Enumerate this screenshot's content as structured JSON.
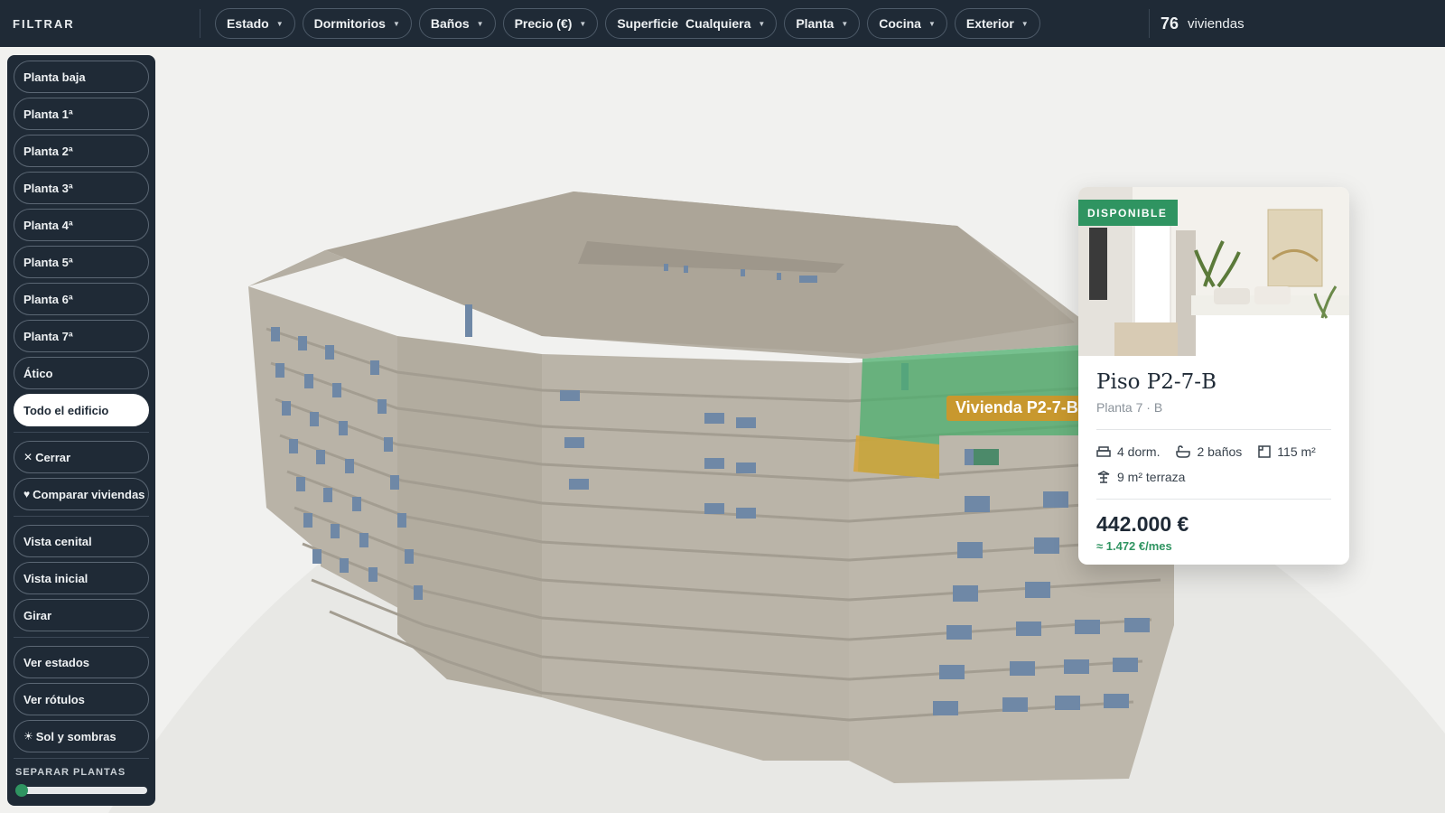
{
  "topbar": {
    "brand": "FILTRAR",
    "filters": [
      {
        "label": "Estado",
        "value": ""
      },
      {
        "label": "Dormitorios",
        "value": ""
      },
      {
        "label": "Baños",
        "value": ""
      },
      {
        "label": "Precio (€)",
        "value": ""
      },
      {
        "label": "Superficie",
        "value": "Cualquiera"
      },
      {
        "label": "Planta",
        "value": ""
      },
      {
        "label": "Cocina",
        "value": ""
      },
      {
        "label": "Exterior",
        "value": ""
      }
    ],
    "count": "76",
    "count_label": "viviendas"
  },
  "sidebar": {
    "floors": [
      "Planta baja",
      "Planta 1ª",
      "Planta 2ª",
      "Planta 3ª",
      "Planta 4ª",
      "Planta 5ª",
      "Planta 6ª",
      "Planta 7ª",
      "Ático",
      "Todo el edificio"
    ],
    "active_floor": "Todo el edificio",
    "close_label": "Cerrar",
    "compare_label": "Comparar viviendas",
    "views": [
      "Vista cenital",
      "Vista inicial",
      "Girar"
    ],
    "toggles": [
      "Ver estados",
      "Ver rótulos",
      "Sol y sombras"
    ],
    "slider_label": "SEPARAR PLANTAS",
    "slider_value": 0
  },
  "scene": {
    "unit_label": "Vivienda P2-7-B",
    "highlight_color": "#4caf6e",
    "terrace_color": "#d8a53a"
  },
  "card": {
    "status": "DISPONIBLE",
    "title": "Piso P2-7-B",
    "subtitle": "Planta 7 · B",
    "bedrooms": "4 dorm.",
    "bathrooms": "2 baños",
    "area": "115 m²",
    "terrace": "9 m² terraza",
    "price": "442.000 €",
    "monthly": "≈ 1.472 €/mes"
  },
  "colors": {
    "bar": "#1f2a36",
    "accent": "#2f9461",
    "facade": "#b8b2a6"
  },
  "icons": {
    "close": "close-icon",
    "compare": "heart-icon",
    "sun": "sun-icon",
    "bed": "bed-icon",
    "bath": "bath-icon",
    "area": "area-icon",
    "terrace": "terrace-icon"
  }
}
